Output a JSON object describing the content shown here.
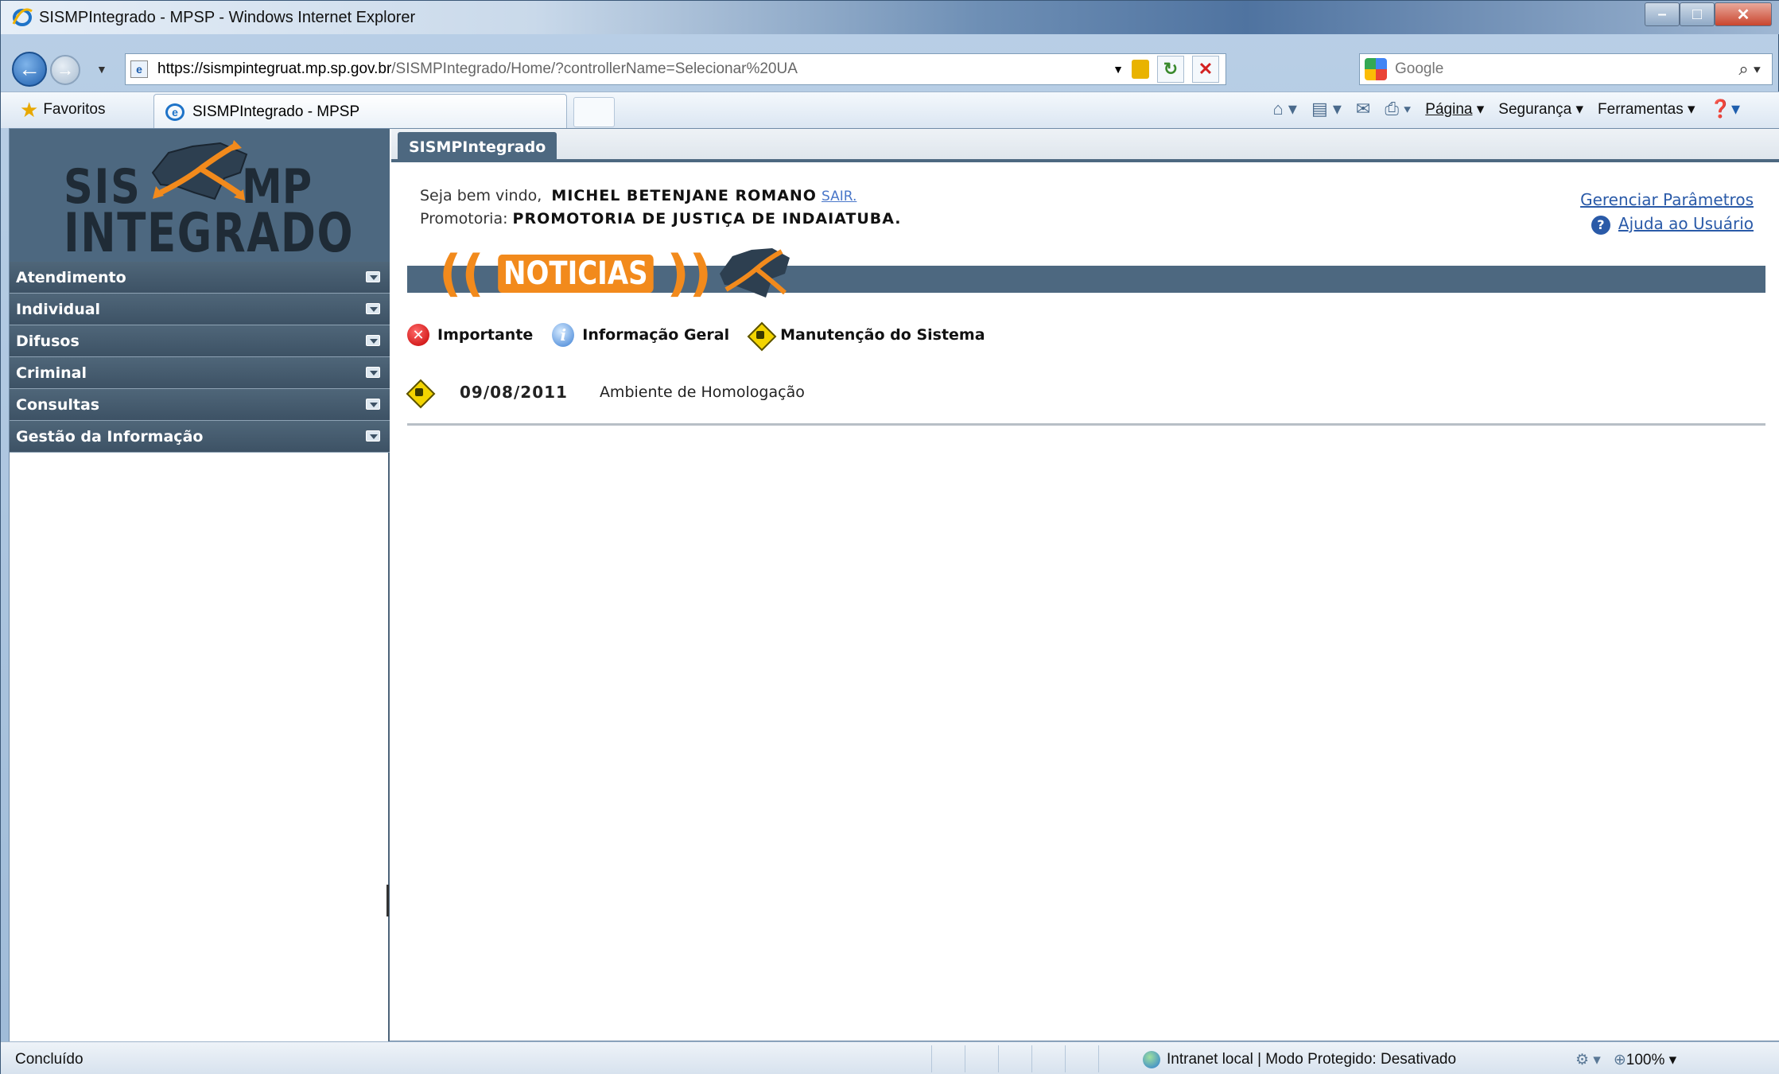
{
  "window": {
    "title": "SISMPIntegrado - MPSP - Windows Internet Explorer"
  },
  "address": {
    "url_host": "https://sismpintegruat.mp.sp.gov.br",
    "url_path": "/SISMPIntegrado/Home/?controllerName=Selecionar%20UA",
    "search_placeholder": "Google"
  },
  "commandbar": {
    "favorites_label": "Favoritos",
    "tab_label": "SISMPIntegrado - MPSP",
    "page_label": "Página",
    "security_label": "Segurança",
    "tools_label": "Ferramentas"
  },
  "logo": {
    "sis": "SIS",
    "mp": "MP",
    "integrado": "INTEGRADO"
  },
  "sidebar": {
    "items": [
      {
        "label": "Atendimento"
      },
      {
        "label": "Individual"
      },
      {
        "label": "Difusos"
      },
      {
        "label": "Criminal"
      },
      {
        "label": "Consultas"
      },
      {
        "label": "Gestão da Informação"
      }
    ]
  },
  "main": {
    "tab_label": "SISMPIntegrado",
    "welcome_prefix": "Seja bem vindo,",
    "user_name": "MICHEL BETENJANE ROMANO",
    "logout_label": "SAIR.",
    "promotoria_prefix": "Promotoria:",
    "promotoria_name": "PROMOTORIA DE JUSTIÇA DE INDAIATUBA.",
    "manage_params_link": "Gerenciar Parâmetros",
    "help_link": "Ajuda ao Usuário",
    "news_title": "NOTICIAS",
    "legend": {
      "important": "Importante",
      "general": "Informação Geral",
      "maintenance": "Manutenção do Sistema"
    },
    "news": [
      {
        "date": "09/08/2011",
        "text": "Ambiente de Homologação"
      }
    ]
  },
  "statusbar": {
    "status": "Concluído",
    "zone": "Intranet local | Modo Protegido: Desativado",
    "zoom": "100%"
  }
}
